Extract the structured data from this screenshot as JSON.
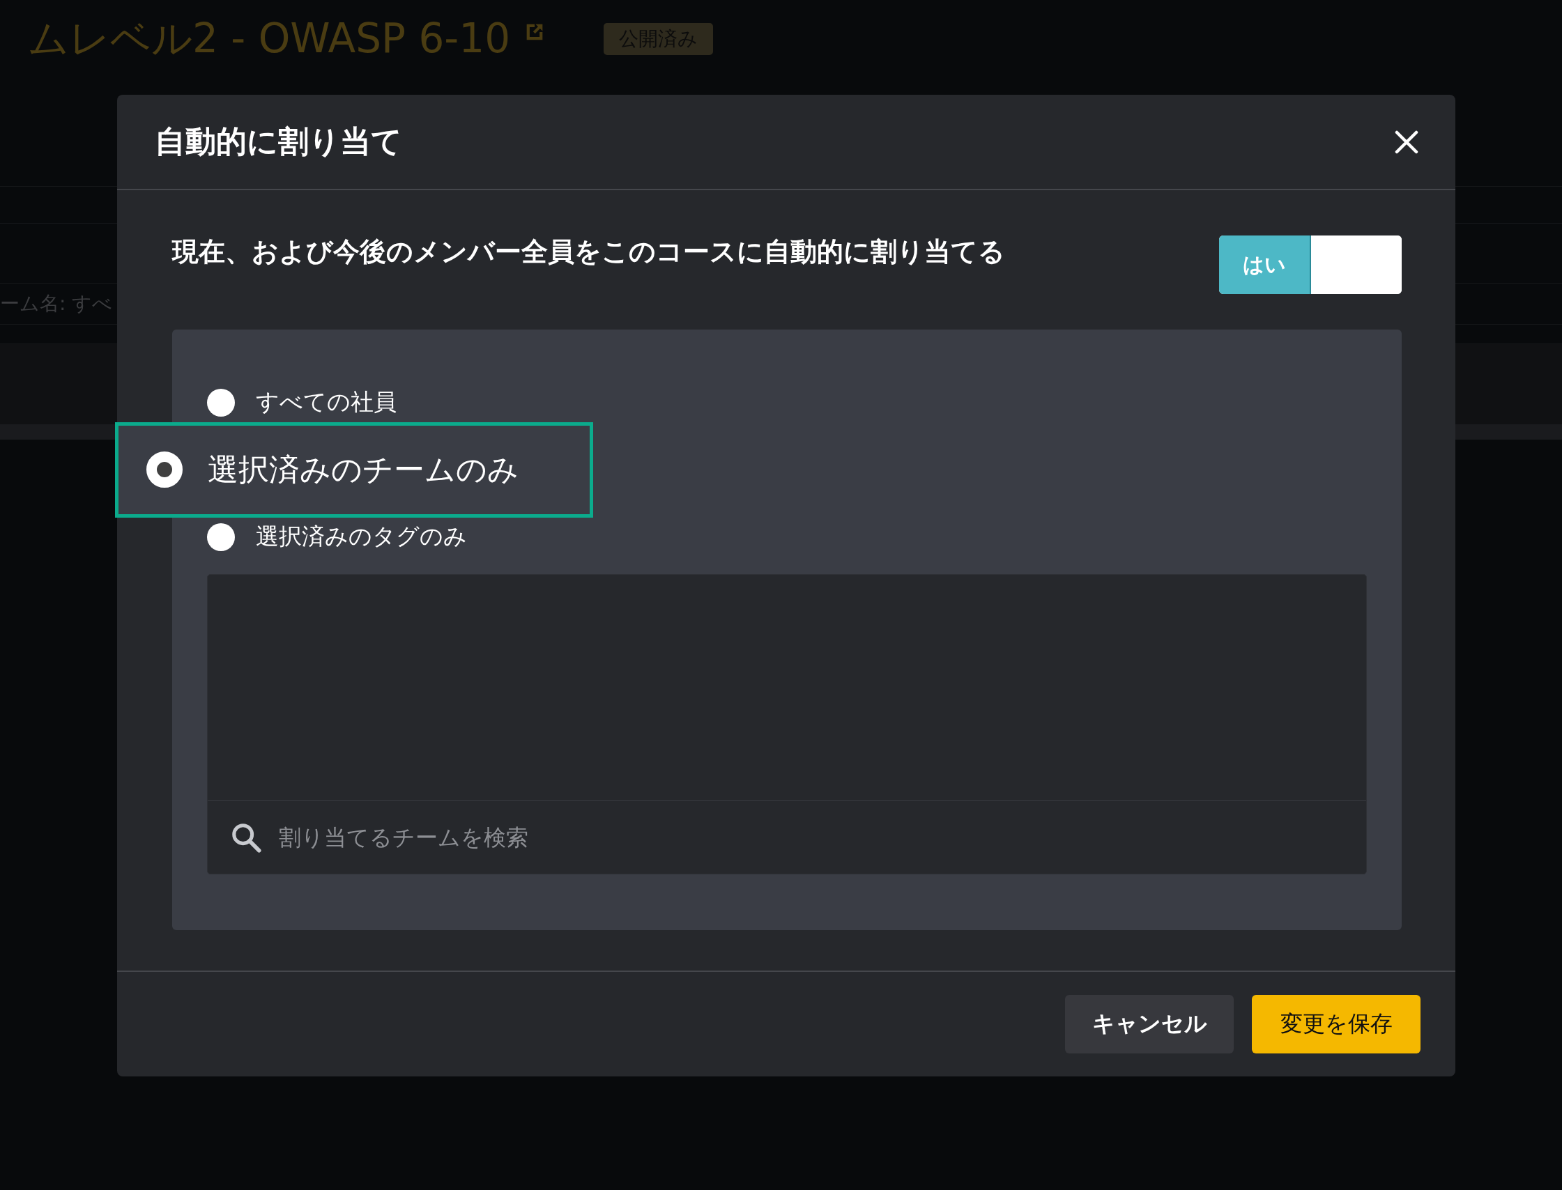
{
  "background": {
    "page_title": "ムレベル2 - OWASP 6-10",
    "status_badge": "公開済み",
    "filter_text": "ーム名: すべ"
  },
  "dialog": {
    "title": "自動的に割り当て",
    "auto_assign": {
      "label": "現在、および今後のメンバー全員をこのコースに自動的に割り当てる",
      "toggle_label": "はい",
      "on": true
    },
    "options": [
      {
        "label": "すべての社員",
        "selected": false,
        "highlighted": false
      },
      {
        "label": "選択済みのチームのみ",
        "selected": true,
        "highlighted": true
      },
      {
        "label": "選択済みのタグのみ",
        "selected": false,
        "highlighted": false
      }
    ],
    "search": {
      "placeholder": "割り当てるチームを検索"
    },
    "buttons": [
      {
        "label": "キャンセル",
        "kind": "secondary"
      },
      {
        "label": "変更を保存",
        "kind": "primary"
      }
    ]
  }
}
